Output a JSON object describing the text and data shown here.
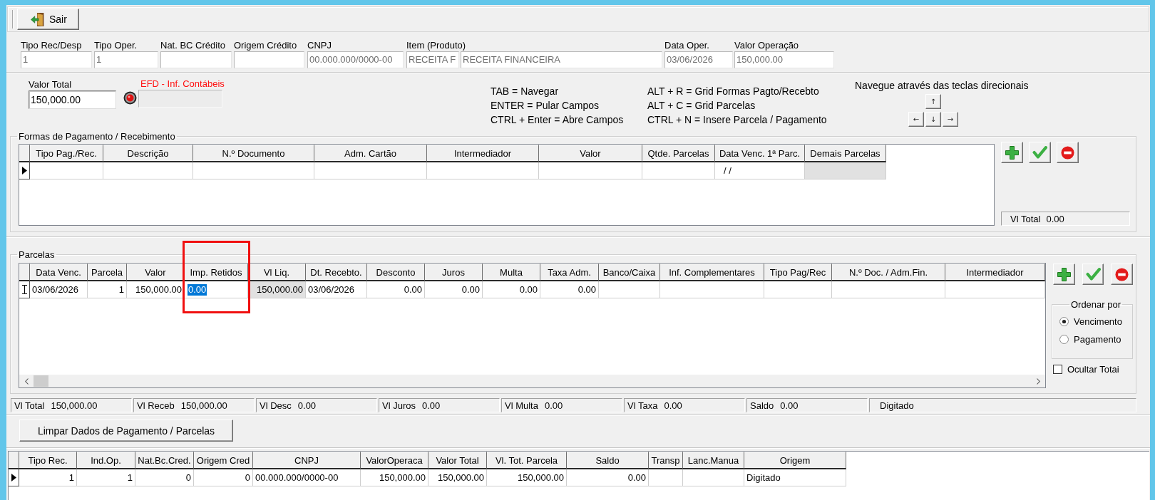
{
  "toolbar": {
    "buttons": [
      {
        "kind": "exit",
        "label": "Sair"
      }
    ]
  },
  "header_fields": [
    {
      "label": "Tipo Rec/Desp",
      "value": "1",
      "disabled": true
    },
    {
      "label": "Tipo Oper.",
      "value": "1",
      "disabled": true
    },
    {
      "label": "Nat. BC Crédito",
      "disabled": true
    },
    {
      "label": "Origem Crédito",
      "disabled": true
    },
    {
      "label": "CNPJ",
      "value": "00.000.000/0000-00",
      "disabled": true
    },
    {
      "label": "Item (Produto)",
      "value": "RECEITA F",
      "disabled": true
    },
    {
      "value": "RECEITA FINANCEIRA",
      "disabled": true
    },
    {
      "label": "Data Oper.",
      "value": "03/06/2026",
      "disabled": true
    },
    {
      "label": "Valor Operação",
      "value": "150,000.00",
      "disabled": true
    }
  ],
  "valor_total": {
    "label": "Valor Total",
    "value": "150,000.00",
    "disabled": false
  },
  "efd": {
    "label": "EFD - Inf. Contábeis",
    "disabled": true
  },
  "shortcut_columns": [
    {
      "lines": [
        "TAB = Navegar",
        "ENTER = Pular Campos",
        "CTRL + Enter = Abre Campos"
      ]
    },
    {
      "lines": [
        "ALT + R = Grid Formas Pagto/Recebto",
        "ALT + C = Grid Parcelas",
        "CTRL + N = Insere Parcela / Pagamento"
      ]
    }
  ],
  "navigation": {
    "hint": "Navegue através das teclas direcionais",
    "keys": [
      {
        "kind": "up",
        "label": "↑"
      },
      {
        "kind": "left",
        "label": "←"
      },
      {
        "kind": "down",
        "label": "↓"
      },
      {
        "kind": "right",
        "label": "→"
      }
    ]
  },
  "payment_methods": {
    "title": "Formas de Pagamento / Recebimento",
    "columns": [
      "Tipo Pag./Rec.",
      "Descrição",
      "N.º Documento",
      "Adm. Cartão",
      "Intermediador",
      "Valor",
      "Qtde. Parcelas",
      "Data Venc. 1ª Parc.",
      "Demais Parcelas"
    ],
    "rows": [
      {
        "kind": "current",
        "cells": [
          {
            "kind": "blank"
          },
          {
            "kind": "blank"
          },
          {
            "kind": "blank"
          },
          {
            "kind": "blank"
          },
          {
            "kind": "blank"
          },
          {
            "kind": "blank"
          },
          {
            "kind": "blank"
          },
          {
            "kind": "text",
            "text": "/ /"
          },
          {
            "kind": "readonly"
          }
        ]
      }
    ],
    "actions": [
      {
        "kind": "add"
      },
      {
        "kind": "confirm"
      },
      {
        "kind": "remove"
      }
    ],
    "total": {
      "label": "Vl Total",
      "value": "0.00"
    }
  },
  "installments": {
    "title": "Parcelas",
    "columns": [
      {
        "label": "Data Venc.",
        "highlighted": false
      },
      {
        "label": "Parcela",
        "highlighted": false
      },
      {
        "label": "Valor",
        "highlighted": false
      },
      {
        "label": "Imp. Retidos",
        "highlighted": true
      },
      {
        "label": "Vl Liq.",
        "highlighted": false
      },
      {
        "label": "Dt. Recebto.",
        "highlighted": false
      },
      {
        "label": "Desconto",
        "highlighted": false
      },
      {
        "label": "Juros",
        "highlighted": false
      },
      {
        "label": "Multa",
        "highlighted": false
      },
      {
        "label": "Taxa Adm.",
        "highlighted": false
      },
      {
        "label": "Banco/Caixa",
        "highlighted": false
      },
      {
        "label": "Inf. Complementares",
        "highlighted": false
      },
      {
        "label": "Tipo Pag/Rec",
        "highlighted": false
      },
      {
        "label": "N.º Doc. / Adm.Fin.",
        "highlighted": false
      },
      {
        "label": "Intermediador",
        "highlighted": false
      }
    ],
    "rows": [
      {
        "kind": "editing",
        "cells": [
          {
            "kind": "text",
            "text": "03/06/2026"
          },
          {
            "kind": "text",
            "text": "1"
          },
          {
            "kind": "text",
            "text": "150,000.00"
          },
          {
            "kind": "editing",
            "text": "0.00"
          },
          {
            "kind": "readonly",
            "text": "150,000.00"
          },
          {
            "kind": "text",
            "text": "03/06/2026"
          },
          {
            "kind": "text",
            "text": "0.00"
          },
          {
            "kind": "text",
            "text": "0.00"
          },
          {
            "kind": "text",
            "text": "0.00"
          },
          {
            "kind": "text",
            "text": "0.00"
          },
          {
            "kind": "blank"
          },
          {
            "kind": "blank"
          },
          {
            "kind": "blank"
          },
          {
            "kind": "blank"
          },
          {
            "kind": "blank"
          }
        ]
      }
    ],
    "actions": [
      {
        "kind": "add"
      },
      {
        "kind": "confirm"
      },
      {
        "kind": "remove"
      }
    ],
    "sort": {
      "title": "Ordenar por",
      "options": [
        {
          "label": "Vencimento",
          "selected": true
        },
        {
          "label": "Pagamento",
          "selected": false
        }
      ]
    },
    "hide_totals": {
      "label": "Ocultar Totai",
      "checked": false
    }
  },
  "totals": [
    {
      "label": "Vl Total",
      "value": "150,000.00"
    },
    {
      "label": "Vl Receb",
      "value": "150,000.00"
    },
    {
      "label": "Vl Desc",
      "value": "0.00"
    },
    {
      "label": "Vl Juros",
      "value": "0.00"
    },
    {
      "label": "Vl Multa",
      "value": "0.00"
    },
    {
      "label": "Vl Taxa",
      "value": "0.00"
    },
    {
      "label": "Saldo",
      "value": "0.00"
    },
    {
      "value": "Digitado"
    }
  ],
  "clear_button": {
    "label": "Limpar Dados de Pagamento / Parcelas"
  },
  "summary_table": {
    "columns": [
      "Tipo Rec.",
      "Ind.Op.",
      "Nat.Bc.Cred.",
      "Origem Cred",
      "CNPJ",
      "ValorOperaca",
      "Valor Total",
      "Vl. Tot. Parcela",
      "Saldo",
      "Transp",
      "Lanc.Manua",
      "Origem"
    ],
    "rows": [
      {
        "kind": "current",
        "cells": [
          {
            "kind": "text",
            "text": "1"
          },
          {
            "kind": "text",
            "text": "1"
          },
          {
            "kind": "text",
            "text": "0"
          },
          {
            "kind": "text",
            "text": "0"
          },
          {
            "kind": "text",
            "text": "00.000.000/0000-00"
          },
          {
            "kind": "text",
            "text": "150,000.00"
          },
          {
            "kind": "text",
            "text": "150,000.00"
          },
          {
            "kind": "text",
            "text": "150,000.00"
          },
          {
            "kind": "text",
            "text": "0.00"
          },
          {
            "kind": "blank"
          },
          {
            "kind": "blank"
          },
          {
            "kind": "text",
            "text": "Digitado"
          }
        ]
      }
    ]
  }
}
